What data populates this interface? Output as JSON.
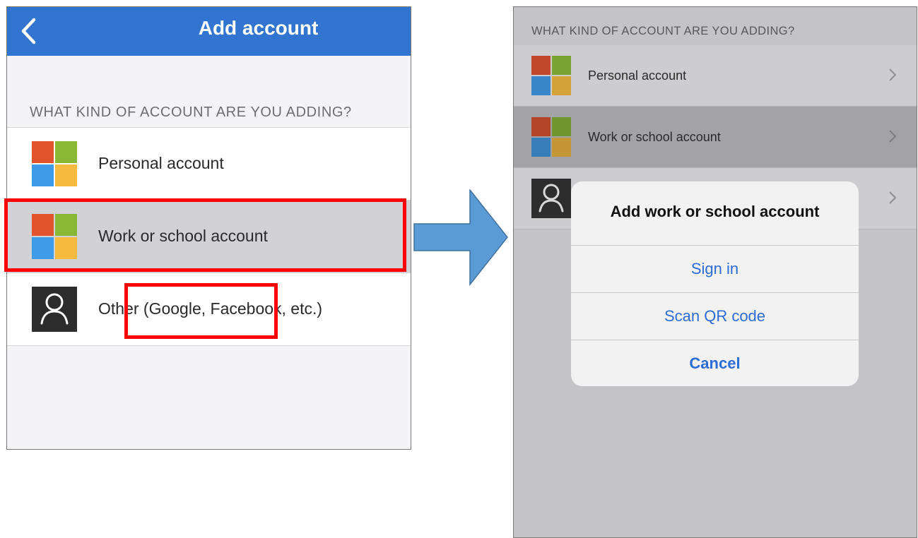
{
  "left_screen": {
    "nav_title": "Add account",
    "back_icon": "chevron-left-icon",
    "section_header": "WHAT KIND OF ACCOUNT ARE YOU ADDING?",
    "items": [
      {
        "label": "Personal account",
        "icon": "microsoft-logo-icon"
      },
      {
        "label": "Work or school account",
        "icon": "microsoft-logo-icon",
        "selected": true
      },
      {
        "label": "Other (Google, Facebook, etc.)",
        "icon": "person-icon"
      }
    ]
  },
  "right_screen": {
    "section_header": "WHAT KIND OF ACCOUNT ARE YOU ADDING?",
    "items": [
      {
        "label": "Personal account",
        "icon": "microsoft-logo-icon"
      },
      {
        "label": "Work or school account",
        "icon": "microsoft-logo-icon",
        "selected": true
      },
      {
        "label": "",
        "icon": "person-icon"
      }
    ],
    "dialog": {
      "title": "Add work or school account",
      "sign_in": "Sign in",
      "scan_qr": "Scan QR code",
      "cancel": "Cancel"
    }
  },
  "colors": {
    "accent_blue": "#3275d0",
    "highlight_red": "#ff0000",
    "arrow_blue": "#5b9bd5",
    "ms_red": "#e2542e",
    "ms_green": "#89b836",
    "ms_blue": "#3d9be9",
    "ms_yellow": "#f6ba3f"
  }
}
